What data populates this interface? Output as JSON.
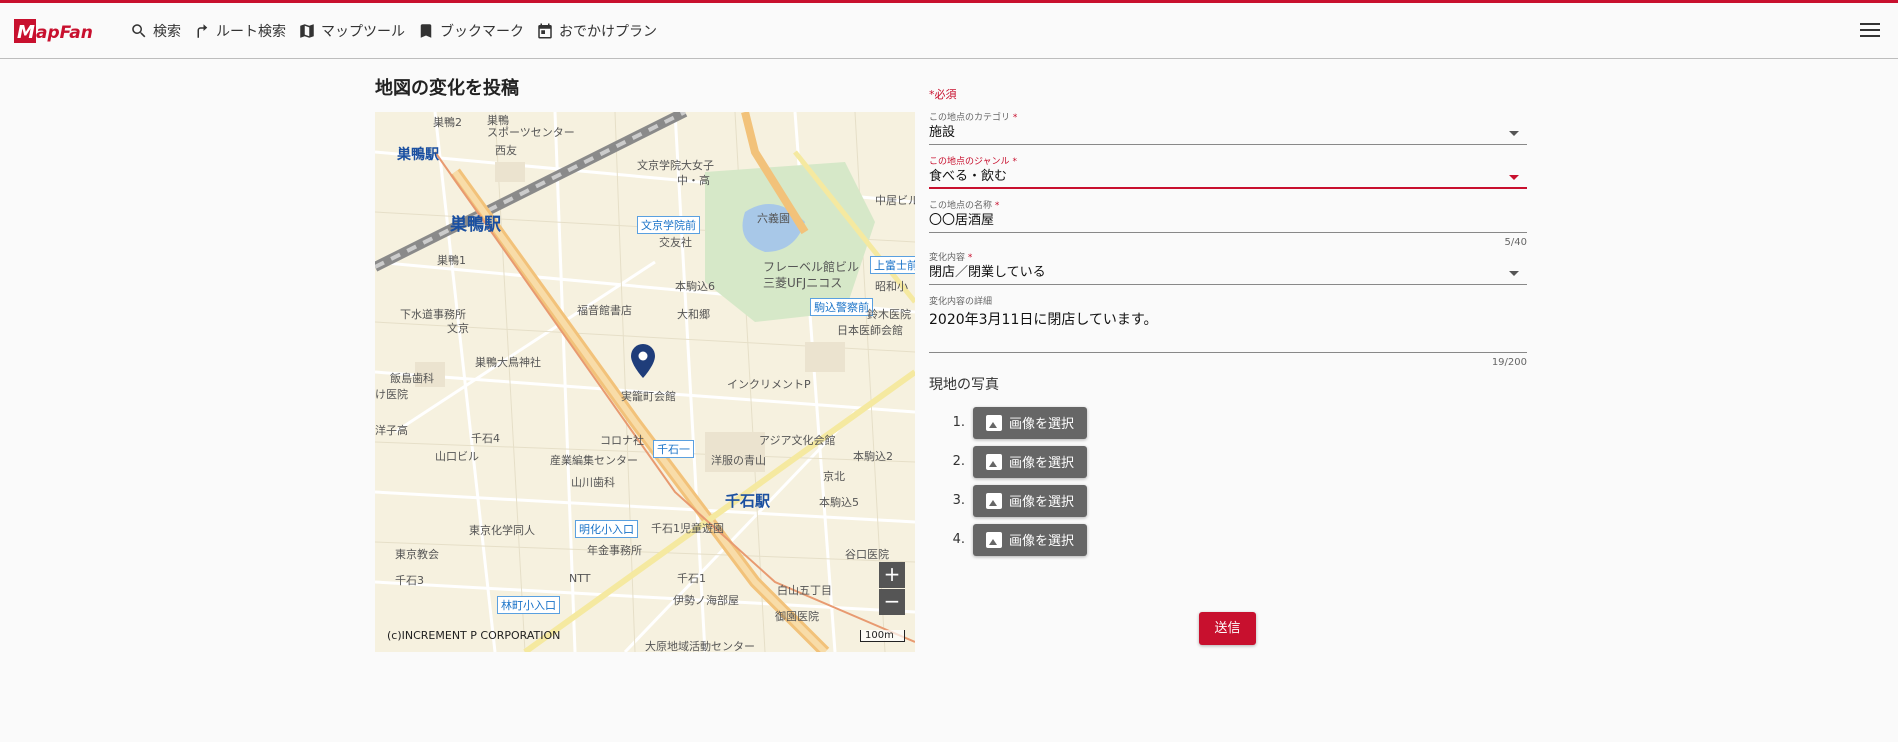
{
  "header": {
    "logo_text": "MapFan",
    "nav": [
      {
        "label": "検索",
        "icon": "search-icon"
      },
      {
        "label": "ルート検索",
        "icon": "route-icon"
      },
      {
        "label": "マップツール",
        "icon": "map-icon"
      },
      {
        "label": "ブックマーク",
        "icon": "bookmark-icon"
      },
      {
        "label": "おでかけプラン",
        "icon": "calendar-icon"
      }
    ],
    "menu_icon": "hamburger-menu-icon"
  },
  "page_title": "地図の変化を投稿",
  "map": {
    "copyright": "(c)INCREMENT P CORPORATION",
    "scale": "100m",
    "zoom_in": "+",
    "zoom_out": "−",
    "labels": {
      "sugamo_station_small": "巣鴨駅",
      "sugamo_station": "巣鴨駅",
      "sengoku_station": "千石駅",
      "sugamo2": "巣鴨2",
      "sugamo_sports": "スポーツセンター",
      "sugamo_sports_top": "巣鴨",
      "nishisu": "西友",
      "bunkyo_girls": "文京学院大女子",
      "chu_ko": "中・高",
      "bunkyo_gakuin_mae": "文京学院前",
      "kouyuu": "交友社",
      "rikugien": "六義園",
      "fureberu": "フレーベル館ビル",
      "mitsubishi": "三菱UFJニコス",
      "honkomagome6": "本駒込6",
      "daiwago": "大和郷",
      "komagome_police": "駒込警察前",
      "kamifuji": "上富士前",
      "showa": "昭和小",
      "suzuki_hp": "鈴木医院",
      "nihon_ishikai": "日本医師会館",
      "sugamo1": "巣鴨1",
      "gesui": "下水道事務所",
      "bunkyo": "文京",
      "fukuin": "福音館書店",
      "sugamo_ootori": "巣鴨大鳥神社",
      "iizuka": "飯島歯科",
      "clinic": "け医院",
      "sengoku4": "千石4",
      "yamaguchi": "山口ビル",
      "sengoku_kaikan": "実籠町会館",
      "increment": "インクリメントP",
      "corona": "コロナ社",
      "sengoku1_sign": "千石一",
      "asia": "アジア文化会館",
      "sangyo": "産業編集センター",
      "youfuku": "洋服の青山",
      "yamakawa": "山川歯科",
      "honkomagome2": "本駒込2",
      "keihoku": "京北",
      "honkomagome5": "本駒込5",
      "meika": "明化小入口",
      "sengoku1_jido": "千石1児童遊園",
      "tokyo_kagaku": "東京化学同人",
      "nenkin": "年金事務所",
      "tokyo_kyokai": "東京教会",
      "sengoku3": "千石3",
      "ntt": "NTT",
      "sengoku1": "千石1",
      "hakusan_gochome": "白山五丁目",
      "iseya": "伊勢ノ海部屋",
      "goinden": "御園医院",
      "yanecho": "谷口医院",
      "hayashi": "林町小入口",
      "ohara": "大原地域活動センター",
      "fujisan": "富士",
      "chuukyo": "中居ビル",
      "yougu": "洋子高"
    }
  },
  "form": {
    "required_note": "*必須",
    "category": {
      "label": "この地点のカテゴリ",
      "value": "施設"
    },
    "genre": {
      "label": "この地点のジャンル",
      "value": "食べる・飲む"
    },
    "name": {
      "label": "この地点の名称",
      "value": "〇〇居酒屋",
      "counter": "5/40"
    },
    "change": {
      "label": "変化内容",
      "value": "閉店／閉業している"
    },
    "detail": {
      "label": "変化内容の詳細",
      "value": "2020年3月11日に閉店しています。",
      "counter": "19/200"
    },
    "required_mark": "*",
    "photos": {
      "title": "現地の写真",
      "items": [
        {
          "num": "1.",
          "label": "画像を選択"
        },
        {
          "num": "2.",
          "label": "画像を選択"
        },
        {
          "num": "3.",
          "label": "画像を選択"
        },
        {
          "num": "4.",
          "label": "画像を選択"
        }
      ]
    },
    "submit": "送信"
  },
  "colors": {
    "brand": "#c8102e",
    "button_gray": "#666666",
    "map_bg": "#f6f1df",
    "park": "#d6e8c8",
    "water": "#a8c8e8"
  }
}
